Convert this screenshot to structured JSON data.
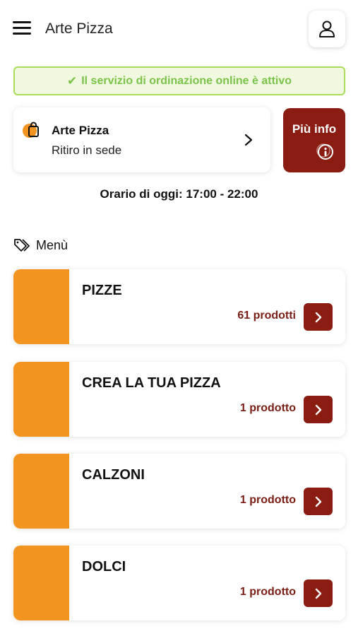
{
  "header": {
    "title": "Arte Pizza",
    "menu_icon": "hamburger-menu-icon",
    "user_icon": "user-icon"
  },
  "status": {
    "text": "Il servizio di ordinazione online è attivo",
    "icon": "check-icon",
    "color": "#7cc24a",
    "background": "#f0f9df",
    "border_color": "#a9dd5b"
  },
  "store": {
    "name": "Arte Pizza",
    "mode": "Ritiro in sede",
    "icon": "shopping-bag-icon"
  },
  "info_button": {
    "label": "Più info",
    "icon": "info-icon",
    "color": "#8b1c12"
  },
  "hours": {
    "text": "Orario di oggi: 17:00 - 22:00"
  },
  "menu": {
    "heading": "Menù",
    "heading_icon": "tag-icon",
    "categories": [
      {
        "name": "PIZZE",
        "count": "61 prodotti"
      },
      {
        "name": "CREA LA TUA PIZZA",
        "count": "1 prodotto"
      },
      {
        "name": "CALZONI",
        "count": "1 prodotto"
      },
      {
        "name": "DOLCI",
        "count": "1 prodotto"
      }
    ],
    "thumb_color": "#f2941f",
    "accent_color": "#8b1c12"
  }
}
